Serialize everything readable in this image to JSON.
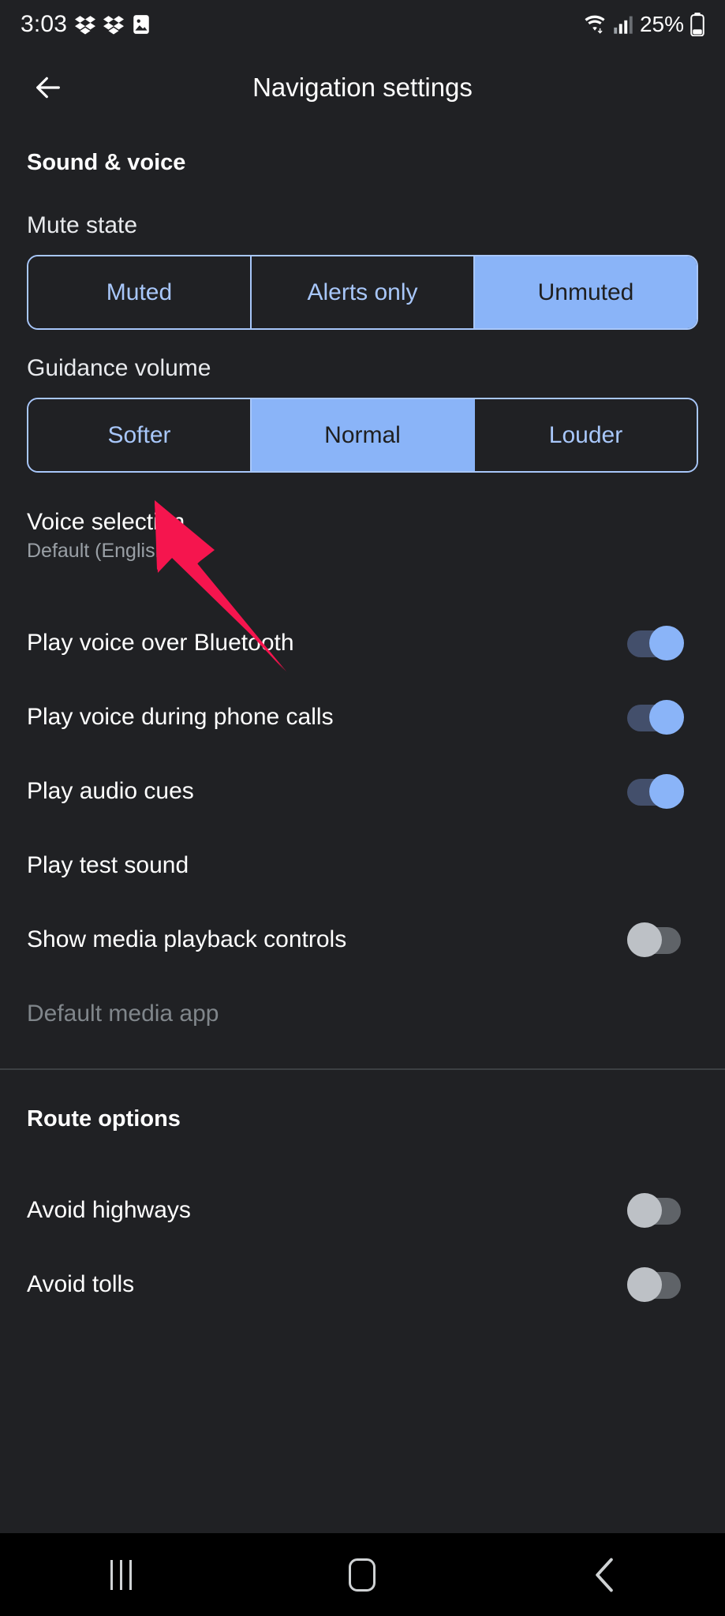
{
  "status_bar": {
    "clock": "3:03",
    "battery_percent": "25%",
    "icons": [
      "dropbox-icon",
      "dropbox-icon",
      "image-icon",
      "wifi-icon",
      "cellular-signal-icon",
      "battery-icon"
    ]
  },
  "app_bar": {
    "title": "Navigation settings",
    "back_label": "Back"
  },
  "sections": {
    "sound_voice": {
      "header": "Sound & voice",
      "mute_state": {
        "label": "Mute state",
        "options": [
          "Muted",
          "Alerts only",
          "Unmuted"
        ],
        "selected": "Unmuted"
      },
      "guidance_volume": {
        "label": "Guidance volume",
        "options": [
          "Softer",
          "Normal",
          "Louder"
        ],
        "selected": "Normal"
      },
      "voice_selection": {
        "title": "Voice selection",
        "subtitle": "Default (English)"
      },
      "rows": [
        {
          "title": "Play voice over Bluetooth",
          "toggle": "on"
        },
        {
          "title": "Play voice during phone calls",
          "toggle": "on"
        },
        {
          "title": "Play audio cues",
          "toggle": "on"
        },
        {
          "title": "Play test sound",
          "toggle": "none"
        },
        {
          "title": "Show media playback controls",
          "toggle": "off"
        },
        {
          "title": "Default media app",
          "toggle": "none",
          "disabled": true
        }
      ]
    },
    "route_options": {
      "header": "Route options",
      "rows": [
        {
          "title": "Avoid highways",
          "toggle": "off"
        },
        {
          "title": "Avoid tolls",
          "toggle": "off"
        }
      ]
    }
  },
  "annotation": {
    "type": "arrow",
    "color": "#F5154E",
    "points_to": "Voice selection"
  },
  "nav_bar": {
    "recents_label": "Recents",
    "home_label": "Home",
    "back_label": "Back"
  },
  "colors": {
    "background": "#202124",
    "accent_selected": "#8ab4f8",
    "accent_outline": "#a8c7fa",
    "toggle_on_track": "#434f6b",
    "toggle_off_thumb": "#bdc1c6",
    "annotation": "#F5154E"
  }
}
